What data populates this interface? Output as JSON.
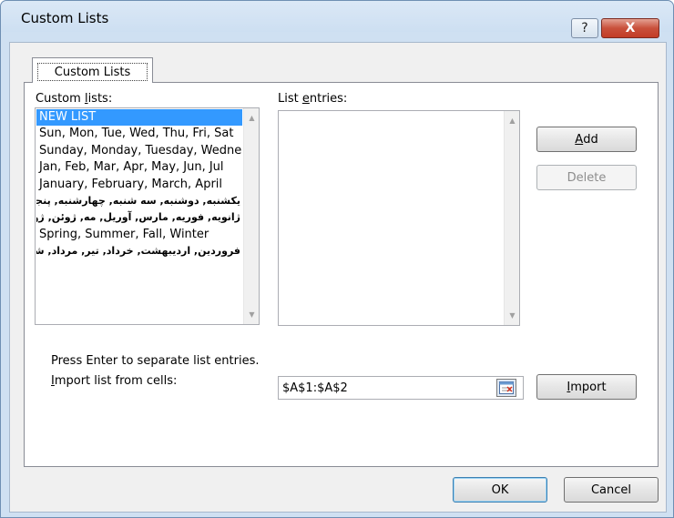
{
  "window": {
    "title": "Custom Lists",
    "help_label": "?",
    "close_label": "X"
  },
  "tabs": [
    {
      "label": "Custom Lists"
    }
  ],
  "custom_lists": {
    "label_pre": "Custom ",
    "label_u": "l",
    "label_post": "ists:",
    "items": [
      "NEW LIST",
      "Sun, Mon, Tue, Wed, Thu, Fri, Sat",
      "Sunday, Monday, Tuesday, Wednesday",
      "Jan, Feb, Mar, Apr, May, Jun, Jul",
      "January, February, March, April",
      "یکشنبه, دوشنبه, سه شنبه, چهارشنبه, پنجشنبه",
      "ژانویه, فوریه, مارس, آوریل, مه, ژوئن, ژوئیه",
      "Spring, Summer, Fall, Winter",
      "فروردین, اردیبهشت, خرداد, تیر, مرداد, شهریور"
    ],
    "selected_index": 0
  },
  "list_entries": {
    "label_pre": "List ",
    "label_u": "e",
    "label_post": "ntries:"
  },
  "buttons": {
    "add_u": "A",
    "add_post": "dd",
    "delete": "Delete",
    "import_u": "I",
    "import_post": "mport",
    "ok": "OK",
    "cancel": "Cancel"
  },
  "hint": "Press Enter to separate list entries.",
  "import": {
    "label_u": "I",
    "label_post": "mport list from cells:",
    "value": "$A$1:$A$2"
  },
  "colors": {
    "selection": "#3399ff",
    "close_button": "#c9503b"
  }
}
